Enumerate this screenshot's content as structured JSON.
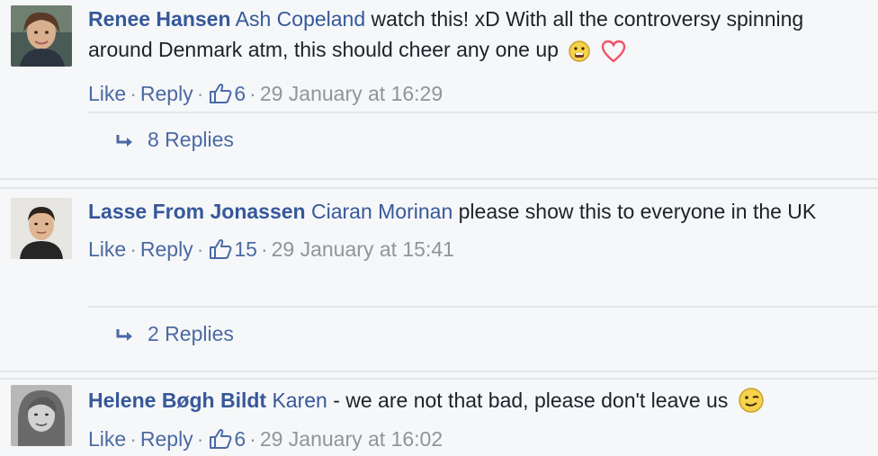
{
  "comments": [
    {
      "author": "Renee Hansen",
      "tag": "Ash Copeland",
      "text": "watch this! xD With all the controversy spinning around Denmark atm, this should cheer any one up",
      "emoji": [
        "smiley-icon",
        "heart-icon"
      ],
      "like_label": "Like",
      "reply_label": "Reply",
      "like_count": "6",
      "timestamp": "29 January at 16:29",
      "replies_label": "8 Replies"
    },
    {
      "author": "Lasse From Jonassen",
      "tag": "Ciaran Morinan",
      "text": "please show this to everyone in the UK",
      "like_label": "Like",
      "reply_label": "Reply",
      "like_count": "15",
      "timestamp": "29 January at 15:41",
      "replies_label": "2 Replies"
    },
    {
      "author": "Helene Bøgh Bildt",
      "tag": "Karen",
      "text": "- we are not that bad, please don't leave us",
      "emoji": [
        "wink-icon"
      ],
      "like_label": "Like",
      "reply_label": "Reply",
      "like_count": "6",
      "timestamp": "29 January at 16:02"
    }
  ],
  "colors": {
    "link": "#365899",
    "meta": "#90949c",
    "background": "#f6f7f9",
    "divider": "#e3e5e9",
    "heart": "#f25268"
  }
}
